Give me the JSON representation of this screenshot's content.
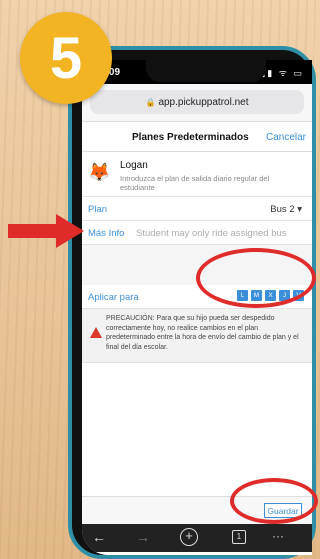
{
  "step": {
    "number": "5"
  },
  "status_bar": {
    "time": "2:09",
    "icons": "▮▮ ᯤ ▭"
  },
  "browser": {
    "url": "app.pickuppatrol.net",
    "share_icon": "share-icon"
  },
  "nav": {
    "title": "Planes Predeterminados",
    "cancel": "Cancelar"
  },
  "student": {
    "name": "Logan",
    "description": "Introduzca el plan de salida diario regular del estudiante",
    "avatar_icon": "fox-icon"
  },
  "plan": {
    "label": "Plan",
    "value": "Bus 2",
    "chevron": "▾"
  },
  "more_info": {
    "label": "Más Info",
    "value": "Student may only ride assigned bus"
  },
  "apply": {
    "label": "Aplicar para",
    "days": [
      "L",
      "M",
      "X",
      "J",
      "V"
    ]
  },
  "caution": {
    "text": "PRECAUCIÓN: Para que su hijo pueda ser despedido correctamente hoy, no realice cambios en el plan predeterminado entre la hora de envío del cambio de plan y el final del día escolar."
  },
  "footer": {
    "save": "Guardar"
  },
  "toolbar": {
    "back": "←",
    "forward": "→",
    "add": "+",
    "tabs": "1",
    "more": "···"
  },
  "colors": {
    "accent": "#3a8fd8",
    "highlight": "#e02b2b",
    "badge": "#f3b423",
    "phone_border": "#2f8fa6"
  }
}
